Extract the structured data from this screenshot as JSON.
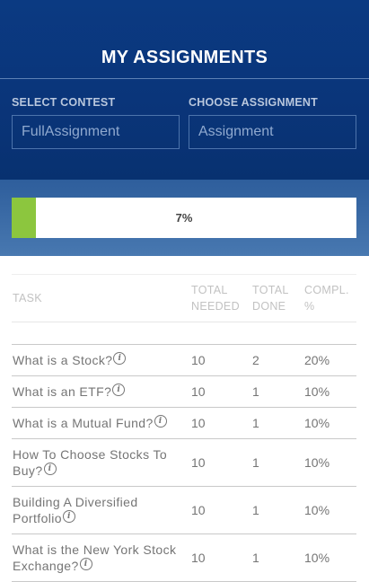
{
  "page": {
    "title": "MY ASSIGNMENTS"
  },
  "filters": {
    "contest_label": "SELECT CONTEST",
    "contest_placeholder": "FullAssignment",
    "assignment_label": "CHOOSE ASSIGNMENT",
    "assignment_placeholder": "Assignment"
  },
  "progress": {
    "value_fraction": 0.07,
    "label": "7%",
    "fill_color": "#8cc63e"
  },
  "table": {
    "headers": {
      "task": "TASK",
      "total_needed_1": "TOTAL",
      "total_needed_2": "NEEDED",
      "total_done_1": "TOTAL",
      "total_done_2": "DONE",
      "compl_1": "COMPL.",
      "compl_2": "%"
    },
    "rows": [
      {
        "task": "What is a Stock?",
        "needed": "10",
        "done": "2",
        "compl": "20%"
      },
      {
        "task": "What is an ETF?",
        "needed": "10",
        "done": "1",
        "compl": "10%"
      },
      {
        "task": "What is a Mutual Fund?",
        "needed": "10",
        "done": "1",
        "compl": "10%"
      },
      {
        "task": "How To Choose Stocks To Buy?",
        "needed": "10",
        "done": "1",
        "compl": "10%"
      },
      {
        "task": "Building A Diversified Portfolio",
        "needed": "10",
        "done": "1",
        "compl": "10%"
      },
      {
        "task": "What is the New York Stock Exchange?",
        "needed": "10",
        "done": "1",
        "compl": "10%"
      }
    ]
  },
  "icons": {
    "info": "info-circle-icon"
  },
  "colors": {
    "header_bg": "#0b3a82",
    "accent_green": "#8cc63e"
  }
}
